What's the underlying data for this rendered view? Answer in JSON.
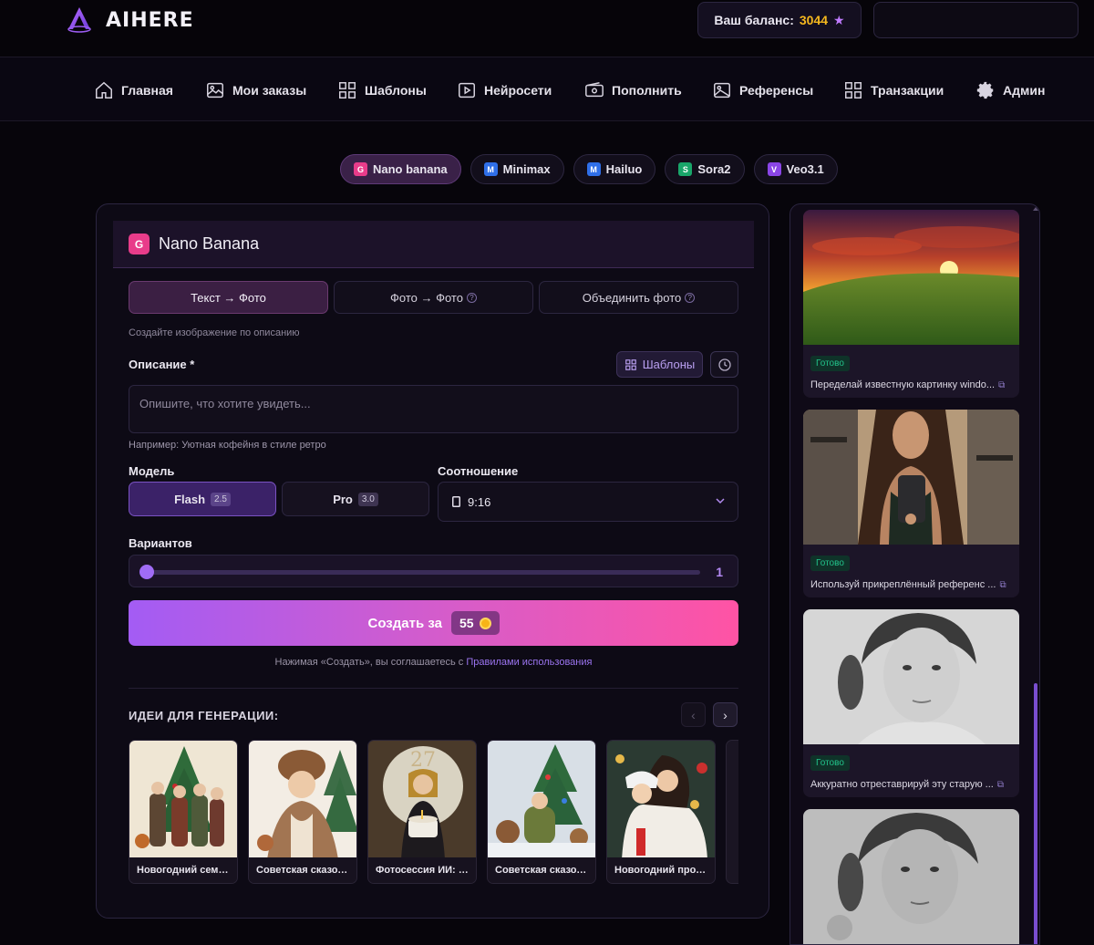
{
  "app": {
    "name": "AIHERE"
  },
  "balance": {
    "label": "Ваш баланс:",
    "amount": "3044",
    "icon": "star-icon",
    "accent": "#f5b81e"
  },
  "nav": [
    {
      "label": "Главная",
      "icon": "home-icon"
    },
    {
      "label": "Мои заказы",
      "icon": "image-icon"
    },
    {
      "label": "Шаблоны",
      "icon": "grid-icon"
    },
    {
      "label": "Нейросети",
      "icon": "play-icon"
    },
    {
      "label": "Пополнить",
      "icon": "wallet-icon"
    },
    {
      "label": "Референсы",
      "icon": "picture-icon"
    },
    {
      "label": "Транзакции",
      "icon": "grid-icon"
    },
    {
      "label": "Админ",
      "icon": "gear-icon"
    }
  ],
  "model_pills": [
    {
      "letter": "G",
      "label": "Nano banana",
      "active": true,
      "color": "#e83c8a"
    },
    {
      "letter": "M",
      "label": "Minimax",
      "active": false,
      "color": "#2f6fe8"
    },
    {
      "letter": "M",
      "label": "Hailuo",
      "active": false,
      "color": "#2f6fe8"
    },
    {
      "letter": "S",
      "label": "Sora2",
      "active": false,
      "color": "#19a66a"
    },
    {
      "letter": "V",
      "label": "Veo3.1",
      "active": false,
      "color": "#8a45e6"
    }
  ],
  "card": {
    "badge": "G",
    "title": "Nano Banana",
    "tabs": [
      "Текст → Фото",
      "Фото → Фото",
      "Объединить фото"
    ],
    "hint": "Создайте изображение по описанию",
    "description": {
      "label": "Описание *",
      "templates_button": "Шаблоны",
      "placeholder": "Опишите, что хотите увидеть...",
      "example": "Например: Уютная кофейня в стиле ретро"
    },
    "model": {
      "label": "Модель",
      "options": [
        {
          "name": "Flash",
          "version": "2.5",
          "active": true
        },
        {
          "name": "Pro",
          "version": "3.0",
          "active": false
        }
      ]
    },
    "ratio": {
      "label": "Соотношение",
      "value": "9:16"
    },
    "variants": {
      "label": "Вариантов",
      "value": "1"
    },
    "create": {
      "label": "Создать за",
      "price": "55"
    },
    "terms": {
      "text": "Нажимая «Создать», вы соглашаетесь с ",
      "link": "Правилами использования"
    },
    "ideas": {
      "title": "ИДЕИ ДЛЯ ГЕНЕРАЦИИ:",
      "items": [
        "Новогодний семе...",
        "Советская сказоч...",
        "Фотосессия ИИ: Г...",
        "Советская сказоч...",
        "Новогодний промт д..."
      ]
    }
  },
  "feed": [
    {
      "status": "Готово",
      "text": "Переделай известную картинку windo..."
    },
    {
      "status": "Готово",
      "text": "Используй прикреплённый референс ..."
    },
    {
      "status": "Готово",
      "text": "Аккуратно отреставрируй эту старую ..."
    },
    {
      "status": "",
      "text": ""
    }
  ]
}
